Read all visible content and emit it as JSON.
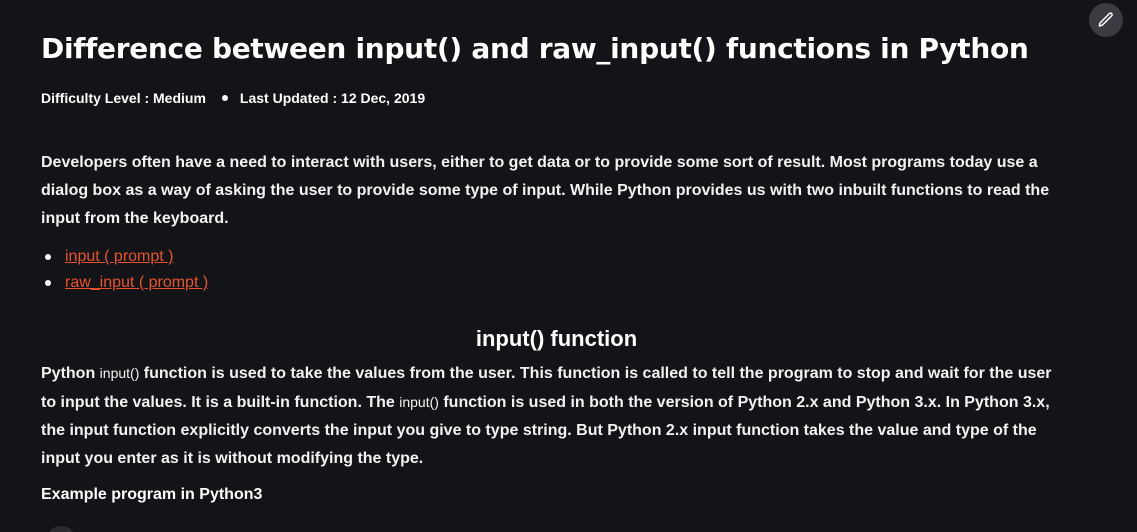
{
  "article": {
    "title": "Difference between input() and raw_input() functions in Python",
    "difficulty": "Difficulty Level : Medium",
    "last_updated": "Last Updated : 12 Dec, 2019",
    "intro": "Developers often have a need to interact with users, either to get data or to provide some sort of result. Most programs today use a dialog box as a way of asking the user to provide some type of input. While Python provides us with two inbuilt functions to read the input from the keyboard.",
    "links": [
      {
        "label": "input ( prompt )"
      },
      {
        "label": "raw_input ( prompt )"
      }
    ],
    "section_heading": "input() function",
    "section": {
      "p1": "Python ",
      "code1": "input()",
      "p2": " function is used to take the values from the user. This function is called to tell the program to stop and wait for the user to input the values. It is a built-in function. The ",
      "code2": "input()",
      "p3": " function is used in both the version of Python 2.x and Python 3.x. In Python 3.x, the input function explicitly converts the input you give to type string. But Python 2.x input function takes the value and type of the input you enter as it is without modifying the type."
    },
    "example_label": "Example program in Python3"
  },
  "toolbar": {
    "edit_icon": "pencil-icon"
  },
  "colors": {
    "background": "#131417",
    "link": "#e9532b",
    "edit_button_bg": "#3a3c42"
  }
}
